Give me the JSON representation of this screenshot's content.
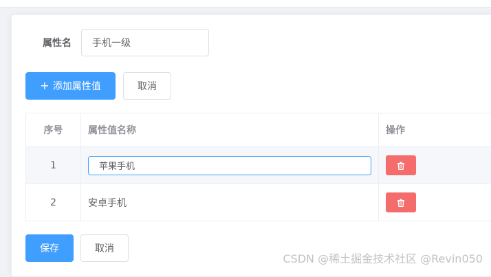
{
  "form": {
    "attr_name_label": "属性名",
    "attr_name_value": "手机一级"
  },
  "toolbar": {
    "add_label": "添加属性值",
    "cancel_label": "取消"
  },
  "table": {
    "headers": [
      "序号",
      "属性值名称",
      "操作"
    ],
    "rows": [
      {
        "index": "1",
        "value": "苹果手机",
        "editing": true
      },
      {
        "index": "2",
        "value": "安卓手机",
        "editing": false
      }
    ]
  },
  "footer": {
    "save_label": "保存",
    "cancel_label": "取消"
  },
  "watermark": "CSDN @稀土掘金技术社区 @Revin050",
  "icons": {
    "add": "plus-icon",
    "delete": "trash-icon"
  },
  "colors": {
    "primary": "#409eff",
    "danger": "#f56c6c"
  }
}
